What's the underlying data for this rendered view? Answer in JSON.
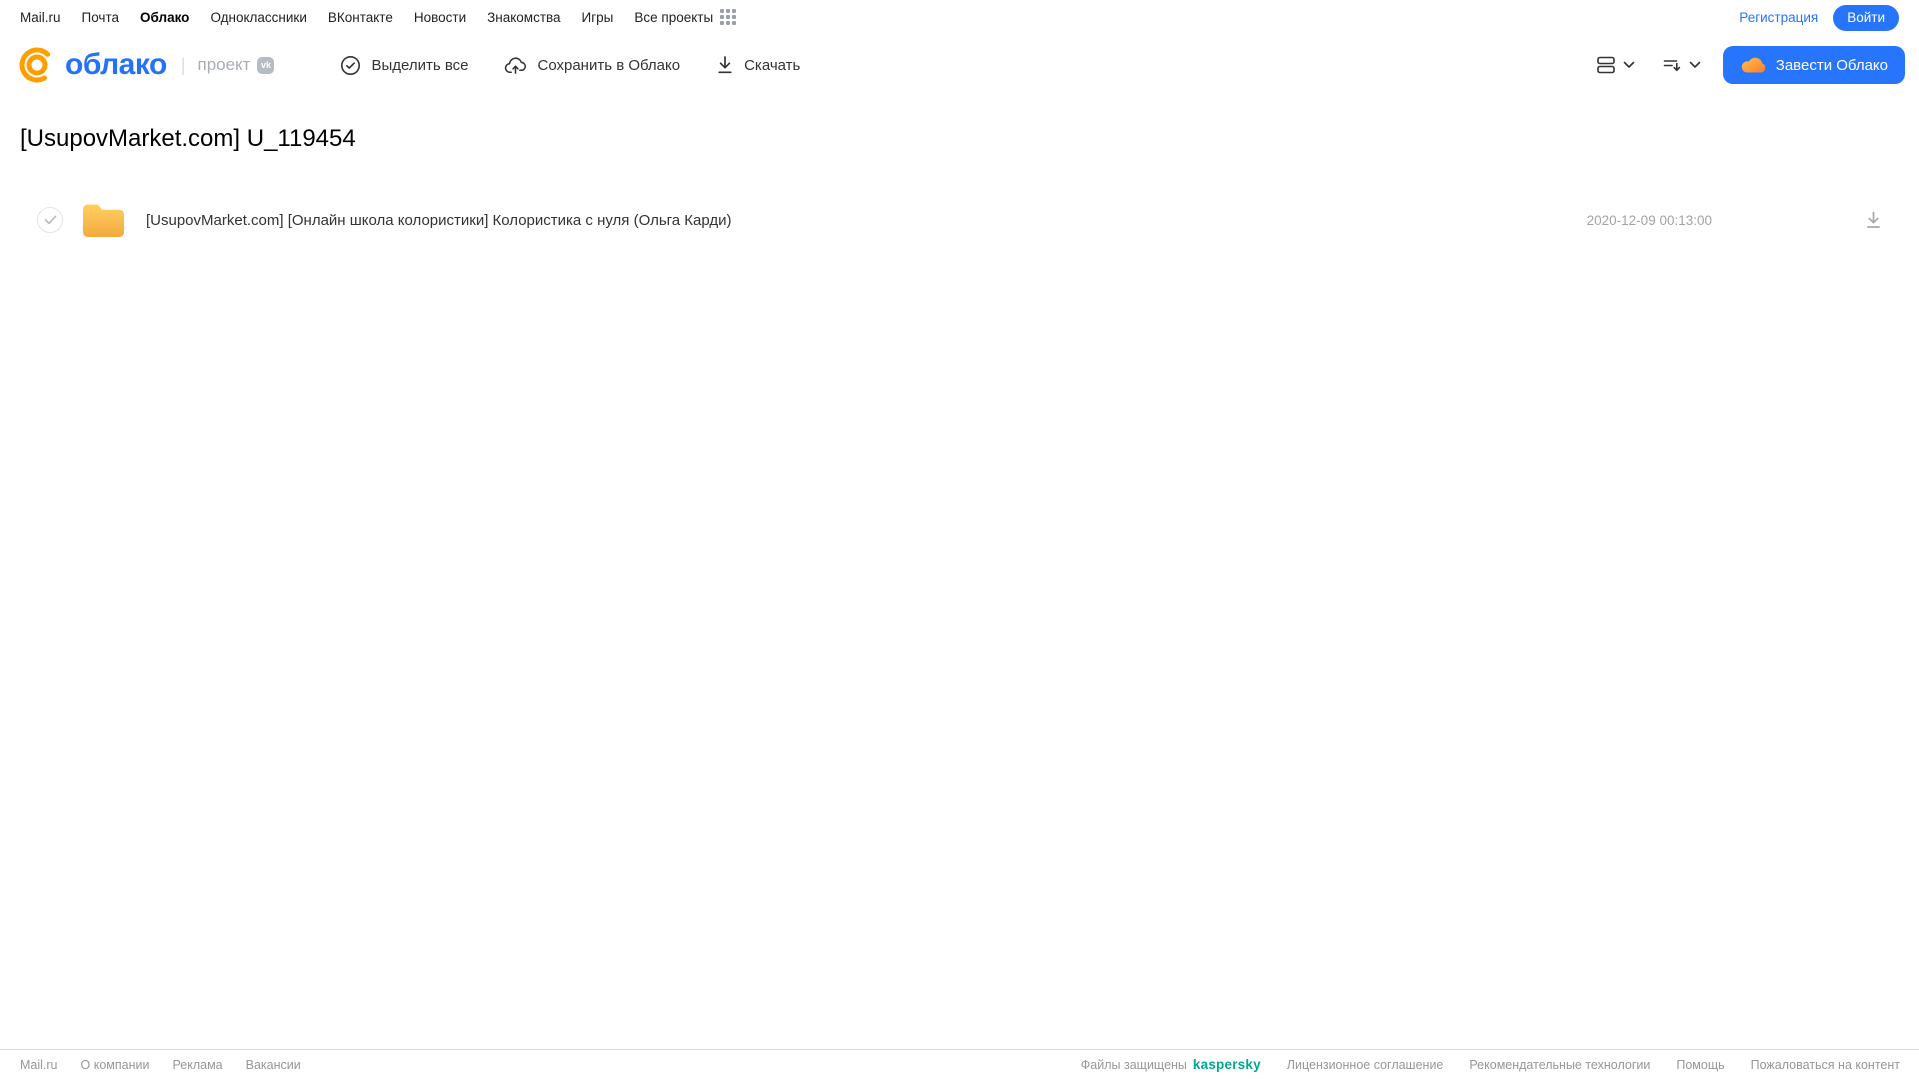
{
  "topnav": {
    "links": [
      {
        "label": "Mail.ru",
        "active": false
      },
      {
        "label": "Почта",
        "active": false
      },
      {
        "label": "Облако",
        "active": true
      },
      {
        "label": "Одноклассники",
        "active": false
      },
      {
        "label": "ВКонтакте",
        "active": false
      },
      {
        "label": "Новости",
        "active": false
      },
      {
        "label": "Знакомства",
        "active": false
      },
      {
        "label": "Игры",
        "active": false
      },
      {
        "label": "Все проекты",
        "active": false
      }
    ],
    "register_label": "Регистрация",
    "login_label": "Войти"
  },
  "header": {
    "logo_text": "облако",
    "project_divider": "|",
    "project_label": "проект",
    "vk_badge_label": "vk",
    "actions": {
      "select_all": "Выделить все",
      "save_to_cloud": "Сохранить в Облако",
      "download": "Скачать"
    },
    "get_cloud_label": "Завести Облако"
  },
  "main": {
    "title": "[UsupovMarket.com] U_119454",
    "files": [
      {
        "type": "folder",
        "name": "[UsupovMarket.com] [Онлайн школа колористики] Колористика с нуля (Ольга Карди)",
        "date": "2020-12-09 00:13:00"
      }
    ]
  },
  "footer": {
    "left_links": [
      "Mail.ru",
      "О компании",
      "Реклама",
      "Вакансии"
    ],
    "protected_text": "Файлы защищены",
    "kaspersky_label": "kaspersky",
    "right_links": [
      "Лицензионное соглашение",
      "Рекомендательные технологии",
      "Помощь",
      "Пожаловаться на контент"
    ]
  },
  "icons": {
    "logo": "at-sign-icon",
    "apps": "apps-grid-icon",
    "select_all": "check-circle-icon",
    "save": "cloud-upload-icon",
    "download": "download-icon",
    "view": "list-view-icon",
    "sort": "sort-icon",
    "cloud": "cloud-icon",
    "folder": "folder-icon"
  },
  "colors": {
    "accent_blue": "#2775fc",
    "logo_orange": "#ff9e00",
    "folder_yellow_top": "#ffd061",
    "folder_yellow_bottom": "#f3a93e",
    "kaspersky_green": "#00a88e"
  }
}
